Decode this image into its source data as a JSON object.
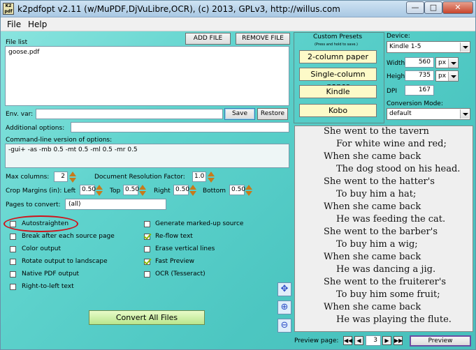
{
  "window": {
    "icon_text": "K2 pdf",
    "title": "k2pdfopt v2.11 (w/MuPDF,DjVuLibre,OCR), (c) 2013, GPLv3, http://willus.com",
    "min_glyph": "—",
    "max_glyph": "□",
    "close_glyph": "✕"
  },
  "menu": [
    "File",
    "Help"
  ],
  "file_list": {
    "label": "File list",
    "add_button": "ADD FILE",
    "remove_button": "REMOVE FILE",
    "files": [
      "goose.pdf"
    ]
  },
  "env_var": {
    "label": "Env. var:",
    "value": "",
    "save_button": "Save",
    "restore_button": "Restore"
  },
  "additional_options": {
    "label": "Additional options:",
    "value": ""
  },
  "command_line": {
    "label": "Command-line version of options:",
    "value": "-gui+ -as -mb 0.5 -mt 0.5 -ml 0.5 -mr 0.5"
  },
  "max_columns": {
    "label": "Max columns:",
    "value": "2"
  },
  "doc_resolution": {
    "label": "Document Resolution Factor:",
    "value": "1.0"
  },
  "crop_margins": {
    "label": "Crop Margins (in): Left",
    "left": "0.50",
    "top_label": "Top",
    "top": "0.50",
    "right_label": "Right",
    "right": "0.50",
    "bottom_label": "Bottom",
    "bottom": "0.50"
  },
  "pages": {
    "label": "Pages to convert:",
    "value": "(all)"
  },
  "options_left": [
    {
      "label": "Autostraighten",
      "checked": false
    },
    {
      "label": "Break after each source page",
      "checked": false
    },
    {
      "label": "Color output",
      "checked": false
    },
    {
      "label": "Rotate output to landscape",
      "checked": false
    },
    {
      "label": "Native PDF output",
      "checked": false
    },
    {
      "label": "Right-to-left text",
      "checked": false
    }
  ],
  "options_right": [
    {
      "label": "Generate marked-up source",
      "checked": false
    },
    {
      "label": "Re-flow text",
      "checked": true
    },
    {
      "label": "Erase vertical lines",
      "checked": false
    },
    {
      "label": "Fast Preview",
      "checked": true
    },
    {
      "label": "OCR (Tesseract)",
      "checked": false
    }
  ],
  "convert_button": "Convert All Files",
  "presets": {
    "title": "Custom Presets",
    "subtitle": "(Press and hold to save.)",
    "items": [
      "2-column paper",
      "Single-column paper",
      "Kindle",
      "Kobo"
    ]
  },
  "device": {
    "label": "Device:",
    "value": "Kindle 1-5",
    "width_label": "Width",
    "width": "560",
    "width_unit": "px",
    "height_label": "Height",
    "height": "735",
    "height_unit": "px",
    "dpi_label": "DPI",
    "dpi": "167",
    "conversion_label": "Conversion Mode:",
    "conversion_value": "default"
  },
  "preview_text": [
    "She went to the tavern",
    "For white wine and red;",
    "When she came back",
    "The dog stood on his head.",
    "She went to the hatter's",
    "To buy him a hat;",
    "When she came back",
    "He was feeding the cat.",
    "She went to the barber's",
    "To buy him a wig;",
    "When she came back",
    "He was dancing a jig.",
    "She went to the fruiterer's",
    "To buy him some fruit;",
    "When she came back",
    "He was playing the flute."
  ],
  "preview_nav": {
    "label": "Preview page:",
    "page": "3",
    "button": "Preview"
  },
  "colors": {
    "accent_ring": "#d0121a",
    "background": "#5fd3cd",
    "preset_fill": "#fdfac8",
    "check": "#8ab800"
  }
}
